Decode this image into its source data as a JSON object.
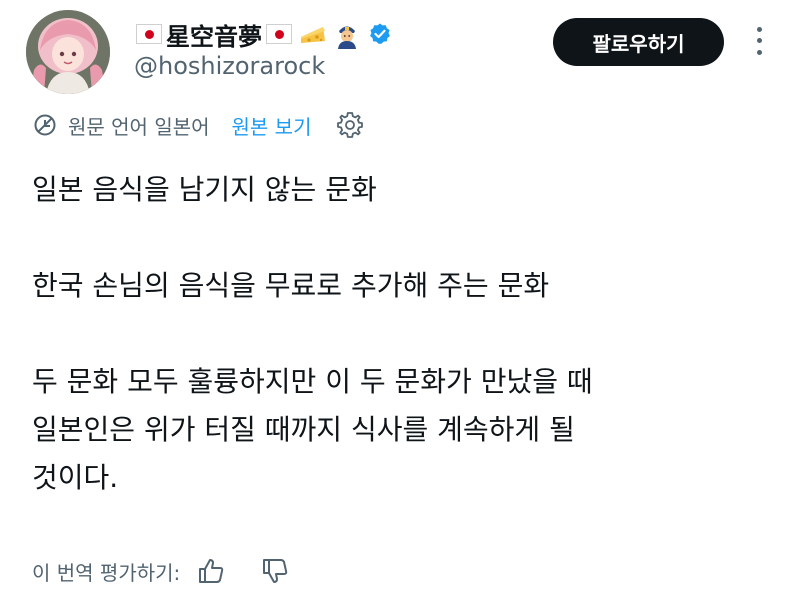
{
  "author": {
    "display_name": "星空音夢",
    "handle": "@hoshizorarock",
    "name_emojis": [
      "jp-flag",
      "jp-flag",
      "cheese-icon",
      "police-officer-icon"
    ],
    "verified": true
  },
  "header": {
    "follow_label": "팔로우하기"
  },
  "translation": {
    "source_text": "원문 언어 일본어",
    "view_original_label": "원본 보기"
  },
  "tweet": {
    "lines": [
      "일본 음식을 남기지 않는 문화",
      "한국 손님의 음식을 무료로 추가해 주는 문화",
      "두 문화 모두 훌륭하지만 이 두 문화가 만났을 때",
      "일본인은 위가 터질 때까지 식사를 계속하게 될",
      "것이다."
    ]
  },
  "feedback": {
    "rate_label": "이 번역 평가하기:"
  },
  "colors": {
    "text": "#0f1419",
    "secondary": "#536471",
    "link": "#1d9bf0",
    "button_bg": "#0f1419",
    "verified": "#1d9bf0"
  }
}
